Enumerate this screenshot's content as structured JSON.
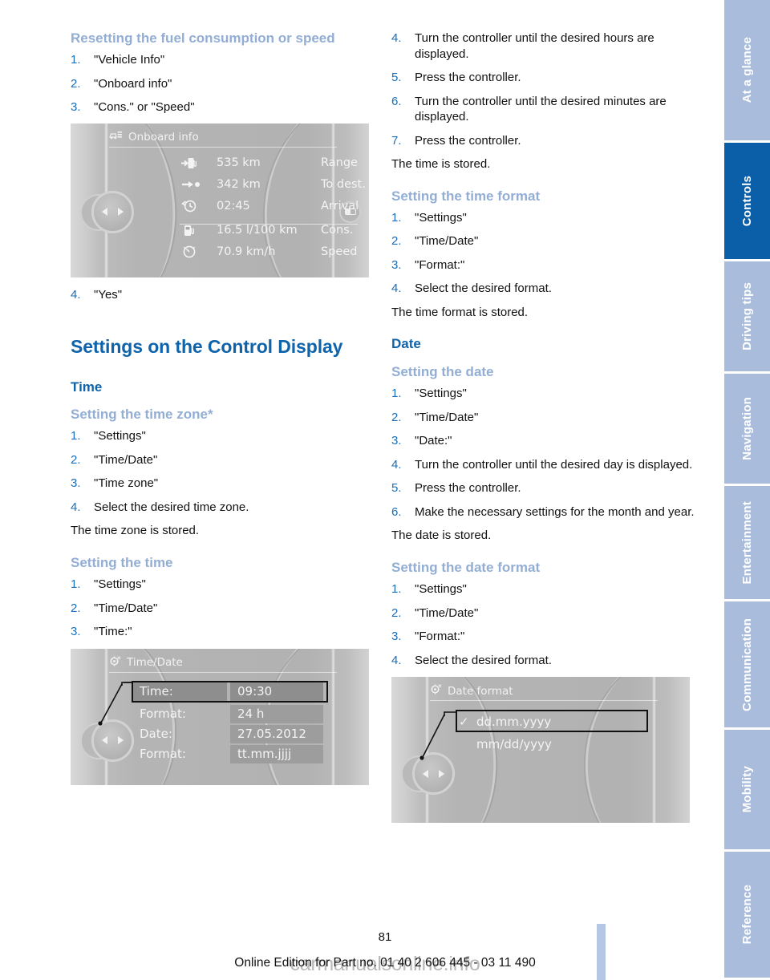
{
  "left_column": {
    "heading_reset": "Resetting the fuel consumption or speed",
    "reset_steps": [
      "\"Vehicle Info\"",
      "\"Onboard info\"",
      "\"Cons.\" or \"Speed\""
    ],
    "reset_step4": "\"Yes\"",
    "heading_settings": "Settings on the Control Display",
    "heading_time": "Time",
    "heading_time_zone": "Setting the time zone*",
    "time_zone_steps": [
      "\"Settings\"",
      "\"Time/Date\"",
      "\"Time zone\"",
      "Select the desired time zone."
    ],
    "time_zone_note": "The time zone is stored.",
    "heading_setting_time": "Setting the time",
    "setting_time_steps": [
      "\"Settings\"",
      "\"Time/Date\"",
      "\"Time:\""
    ]
  },
  "right_column": {
    "time_steps_cont": [
      {
        "num": "4.",
        "text": "Turn the controller until the desired hours are displayed."
      },
      {
        "num": "5.",
        "text": "Press the controller."
      },
      {
        "num": "6.",
        "text": "Turn the controller until the desired minutes are displayed."
      },
      {
        "num": "7.",
        "text": "Press the controller."
      }
    ],
    "time_stored_note": "The time is stored.",
    "heading_time_format": "Setting the time format",
    "time_format_steps": [
      "\"Settings\"",
      "\"Time/Date\"",
      "\"Format:\"",
      "Select the desired format."
    ],
    "time_format_note": "The time format is stored.",
    "heading_date": "Date",
    "heading_setting_date": "Setting the date",
    "setting_date_steps": [
      {
        "num": "1.",
        "text": "\"Settings\""
      },
      {
        "num": "2.",
        "text": "\"Time/Date\""
      },
      {
        "num": "3.",
        "text": "\"Date:\""
      },
      {
        "num": "4.",
        "text": "Turn the controller until the desired day is displayed."
      },
      {
        "num": "5.",
        "text": "Press the controller."
      },
      {
        "num": "6.",
        "text": "Make the necessary settings for the month and year."
      }
    ],
    "date_stored_note": "The date is stored.",
    "heading_date_format": "Setting the date format",
    "date_format_steps": [
      "\"Settings\"",
      "\"Time/Date\"",
      "\"Format:\"",
      "Select the desired format."
    ]
  },
  "figure_onboard": {
    "title": "Onboard info",
    "rows": [
      {
        "icon": "fuel-pump-arrow-icon",
        "value": "535 km",
        "label": "Range"
      },
      {
        "icon": "arrow-to-dot-icon",
        "value": "342 km",
        "label": "To dest."
      },
      {
        "icon": "clock-arrow-icon",
        "value": "02:45",
        "label": "Arrival"
      },
      {
        "icon": "fuel-pump-icon",
        "value": "16.5 l/100 km",
        "label": "Cons."
      },
      {
        "icon": "speedometer-icon",
        "value": "70.9 km/h",
        "label": "Speed"
      }
    ]
  },
  "figure_timedate": {
    "title": "Time/Date",
    "rows": [
      {
        "label": "Time:",
        "value": "09:30",
        "selected": true
      },
      {
        "label": "Format:",
        "value": "24 h",
        "selected": false
      },
      {
        "label": "Date:",
        "value": "27.05.2012",
        "selected": false
      },
      {
        "label": "Format:",
        "value": "tt.mm.jjjj",
        "selected": false
      }
    ]
  },
  "figure_dateformat": {
    "title": "Date format",
    "options": [
      {
        "label": "dd.mm.yyyy",
        "checked": true,
        "selected": true
      },
      {
        "label": "mm/dd/yyyy",
        "checked": false,
        "selected": false
      }
    ]
  },
  "sidebar": {
    "tabs": [
      {
        "label": "At a glance",
        "active": false
      },
      {
        "label": "Controls",
        "active": true
      },
      {
        "label": "Driving tips",
        "active": false
      },
      {
        "label": "Navigation",
        "active": false
      },
      {
        "label": "Entertainment",
        "active": false
      },
      {
        "label": "Communication",
        "active": false
      },
      {
        "label": "Mobility",
        "active": false
      },
      {
        "label": "Reference",
        "active": false
      }
    ]
  },
  "footer": {
    "page_number": "81",
    "edition_line": "Online Edition for Part no. 01 40 2 606 445 - 03 11 490",
    "watermark": "carmanualsonline.info"
  },
  "colors": {
    "heading_strong_blue": "#0e63ab",
    "heading_light_blue": "#93aed5",
    "list_number_blue": "#1a6fb8",
    "tab_inactive": "#aabcdc",
    "tab_active": "#0b5fa8",
    "page_marker": "#b6c7e4"
  }
}
